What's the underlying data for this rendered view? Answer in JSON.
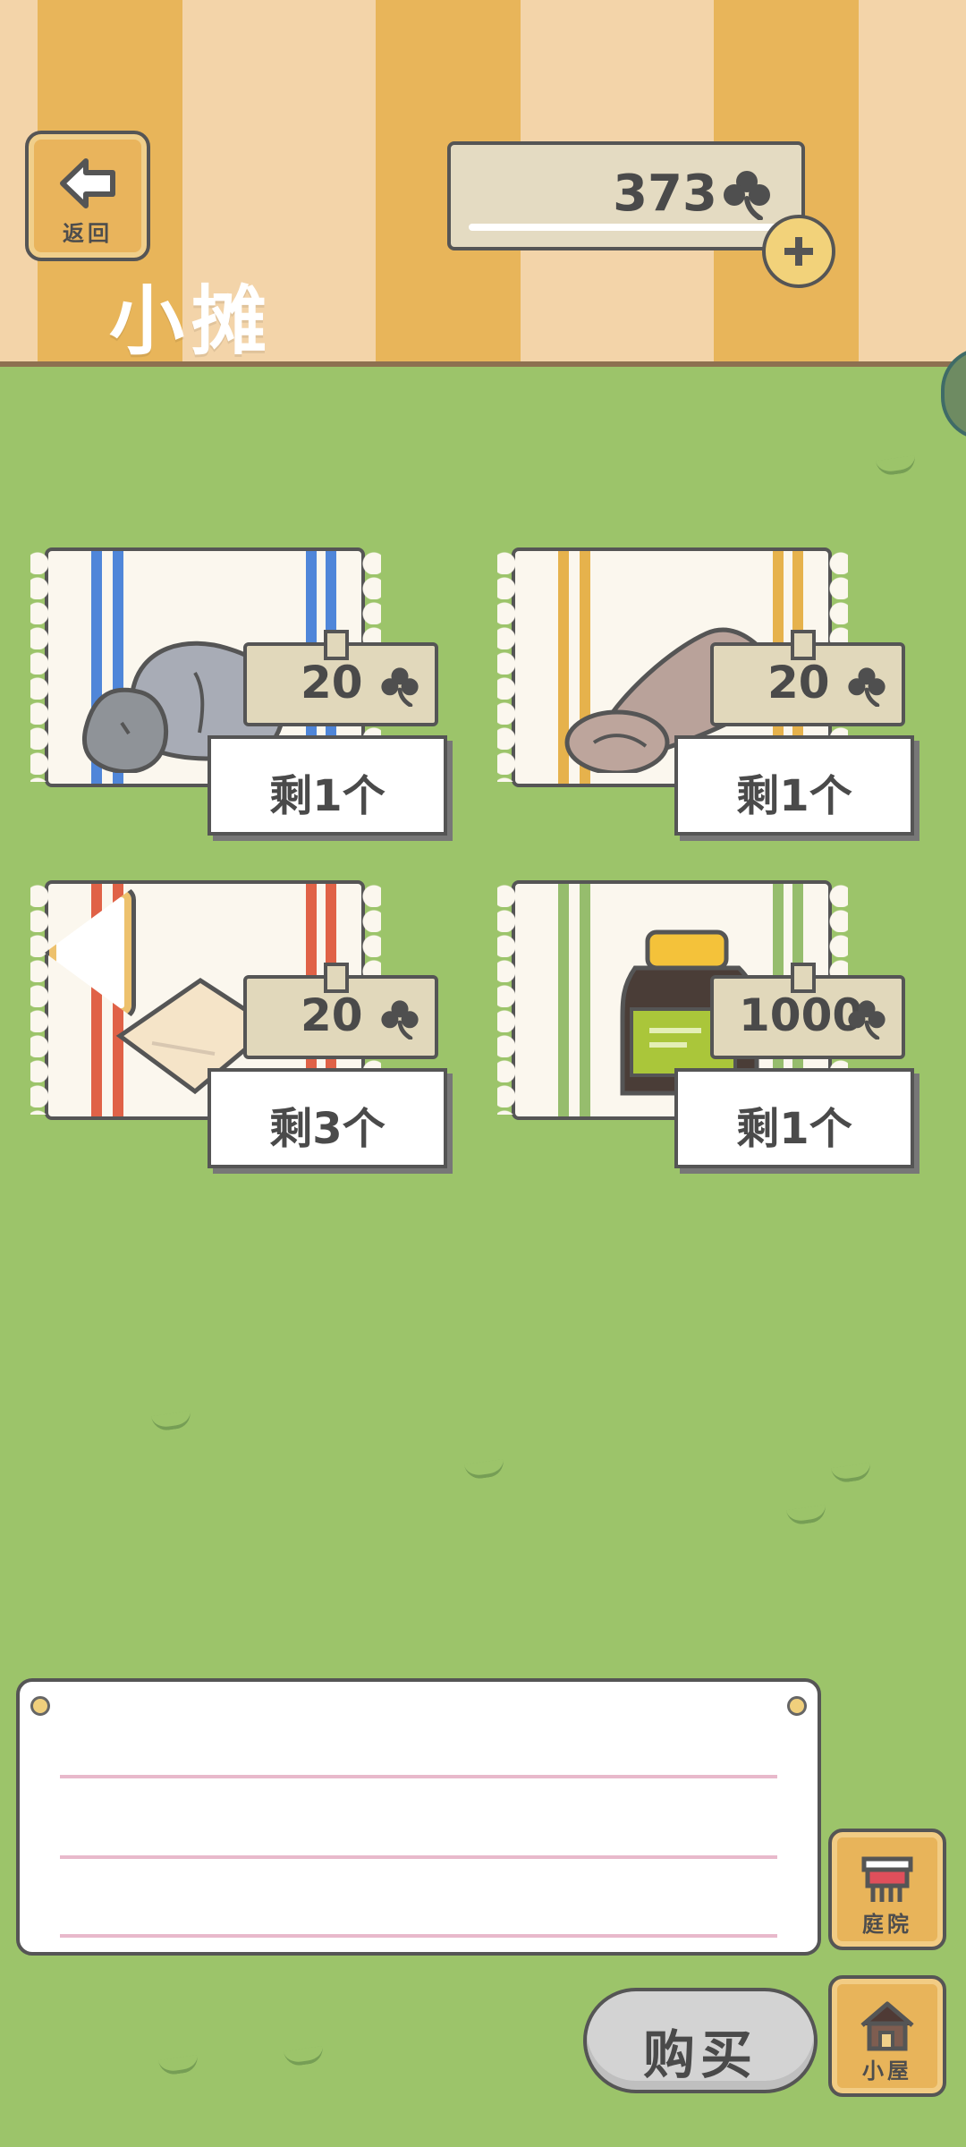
{
  "header": {
    "back_label": "返回",
    "title": "小摊",
    "coins": "373"
  },
  "items": [
    {
      "price": "20",
      "stock": "剩1个",
      "stripe_color": "#4f86d9",
      "item": "rock-bag"
    },
    {
      "price": "20",
      "stock": "剩1个",
      "stripe_color": "#e6b24c",
      "item": "rolled-blanket"
    },
    {
      "price": "20",
      "stock": "剩3个",
      "stripe_color": "#e06247",
      "item": "folded-cloth"
    },
    {
      "price": "1000",
      "stock": "剩1个",
      "stripe_color": "#96bd6d",
      "item": "bottle"
    }
  ],
  "bottom": {
    "buy_label": "购买",
    "yard_label": "庭院",
    "house_label": "小屋"
  },
  "colors": {
    "grass": "#9cc46a",
    "header_light": "#f3d4a9",
    "header_dark": "#e8b55a"
  }
}
